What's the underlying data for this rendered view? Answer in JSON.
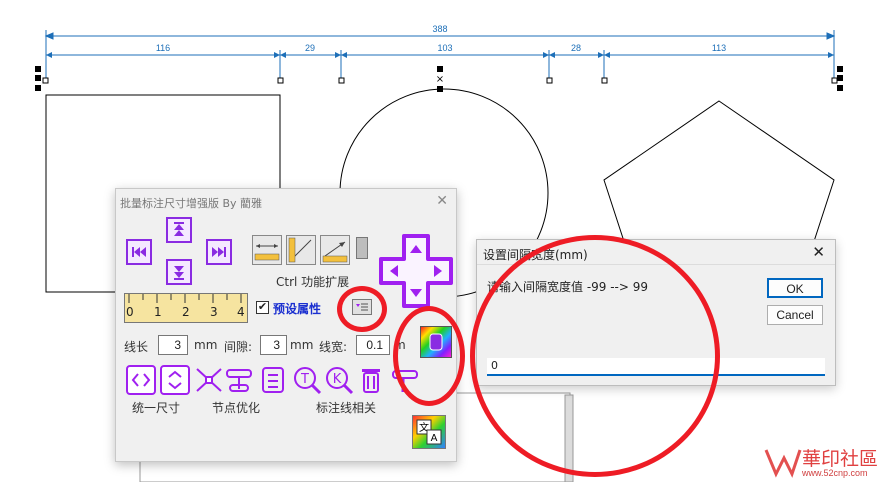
{
  "drawing": {
    "dimensions": {
      "total": "388",
      "gaps": [
        "116",
        "29",
        "103",
        "28",
        "113"
      ]
    }
  },
  "tool_window": {
    "title": "批量标注尺寸增强版 By 藺雅",
    "close": "✕",
    "ctrl_ext_label": "Ctrl 功能扩展",
    "preset_label": "预设属性",
    "preset_checked": true,
    "ruler_numbers": [
      "0",
      "1",
      "2",
      "3",
      "4"
    ],
    "line_length_label": "线长",
    "line_length_value": "3",
    "gap_label": "间隙:",
    "gap_value": "3",
    "line_width_label": "线宽:",
    "line_width_value": "0.1",
    "unit_mm": "mm",
    "unit_mm_partial": "m",
    "group_labels": [
      "统一尺寸",
      "节点优化",
      "标注线相关"
    ]
  },
  "dialog": {
    "title": "设置间隔宽度(mm)",
    "close": "✕",
    "prompt": "请输入间隔宽度值 -99 --> 99",
    "ok_label": "OK",
    "cancel_label": "Cancel",
    "input_value": "0"
  },
  "watermark": {
    "text": "華印社區",
    "url": "www.52cnp.com"
  },
  "colors": {
    "accent_purple": "#a020f0",
    "dimension_blue": "#1d6fb8",
    "highlight_red": "#ee1c25"
  }
}
